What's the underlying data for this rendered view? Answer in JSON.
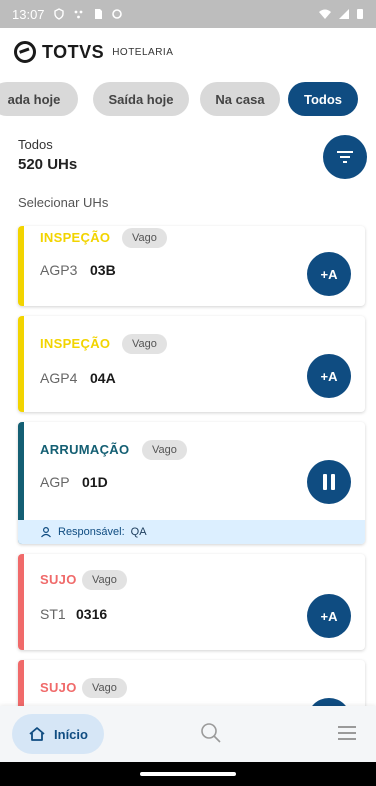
{
  "status_bar": {
    "time": "13:07",
    "left_icons": [
      "shield-icon",
      "signal-dots-icon",
      "sim-icon",
      "circle-icon"
    ],
    "right_icons": [
      "wifi-icon",
      "cellular-icon",
      "battery-icon"
    ]
  },
  "brand": {
    "name": "TOTVS",
    "sub": "HOTELARIA"
  },
  "chips": [
    {
      "label": "ada hoje",
      "active": false
    },
    {
      "label": "Saída hoje",
      "active": false
    },
    {
      "label": "Na casa",
      "active": false
    },
    {
      "label": "Todos",
      "active": true
    }
  ],
  "summary": {
    "label": "Todos",
    "count": "520 UHs"
  },
  "select_label": "Selecionar UHs",
  "cards": [
    {
      "status": "INSPEÇÃO",
      "status_color": "#f2d400",
      "badge": "Vago",
      "prefix": "AGP3",
      "number": "03B",
      "action": "+A"
    },
    {
      "status": "INSPEÇÃO",
      "status_color": "#f2d400",
      "badge": "Vago",
      "prefix": "AGP4",
      "number": "04A",
      "action": "+A"
    },
    {
      "status": "ARRUMAÇÃO",
      "status_color": "#145f73",
      "badge": "Vago",
      "prefix": "AGP",
      "number": "01D",
      "action": "pause",
      "responsible_label": "Responsável:",
      "responsible_name": "QA"
    },
    {
      "status": "SUJO",
      "status_color": "#f06a6a",
      "badge": "Vago",
      "prefix": "ST1",
      "number": "0316",
      "action": "+A"
    },
    {
      "status": "SUJO",
      "status_color": "#f06a6a",
      "badge": "Vago"
    }
  ],
  "bottom_nav": {
    "home_label": "Início"
  },
  "colors": {
    "primary": "#0f4c81",
    "chip_bg": "#d9d9d9"
  }
}
